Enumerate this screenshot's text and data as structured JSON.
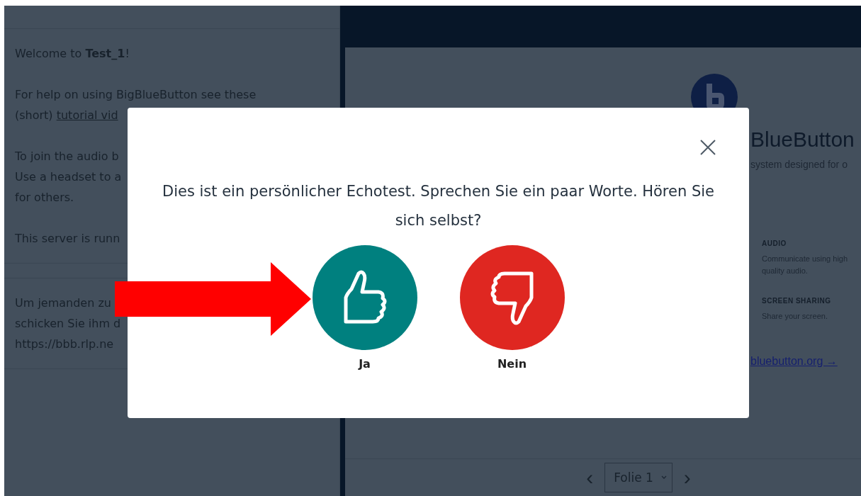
{
  "welcome_panel": {
    "paragraphs": [
      [
        {
          "text": "Welcome to **Test_1**!"
        }
      ],
      [
        {
          "text": "For help on using BigBlueButton see these"
        },
        {
          "text": "(short) ",
          "link": "tutorial vid"
        }
      ],
      [
        {
          "text": "To join the audio b"
        },
        {
          "text": "Use a headset to a"
        },
        {
          "text": "for others."
        }
      ],
      [
        {
          "text": "This server is runn"
        }
      ]
    ]
  },
  "invite_panel": {
    "lines": [
      "Um jemanden zu",
      "schicken Sie ihm d",
      "https://bbb.rlp.ne"
    ]
  },
  "slide": {
    "title": "BlueButton",
    "subtitle": "system designed for o",
    "features": [
      {
        "heading": "AUDIO",
        "text": "Communicate using high quality audio."
      },
      {
        "heading": "SCREEN SHARING",
        "text": "Share your screen."
      }
    ],
    "link": "bluebutton.org →"
  },
  "slide_controls": {
    "prev": "‹",
    "page": "Folie 1",
    "next": "›"
  },
  "modal": {
    "message": "Dies ist ein persönlicher Echotest. Sprechen Sie ein paar Worte. Hören Sie sich selbst?",
    "buttons": [
      {
        "kind": "yes",
        "label": "Ja"
      },
      {
        "kind": "no",
        "label": "Nein"
      }
    ]
  }
}
